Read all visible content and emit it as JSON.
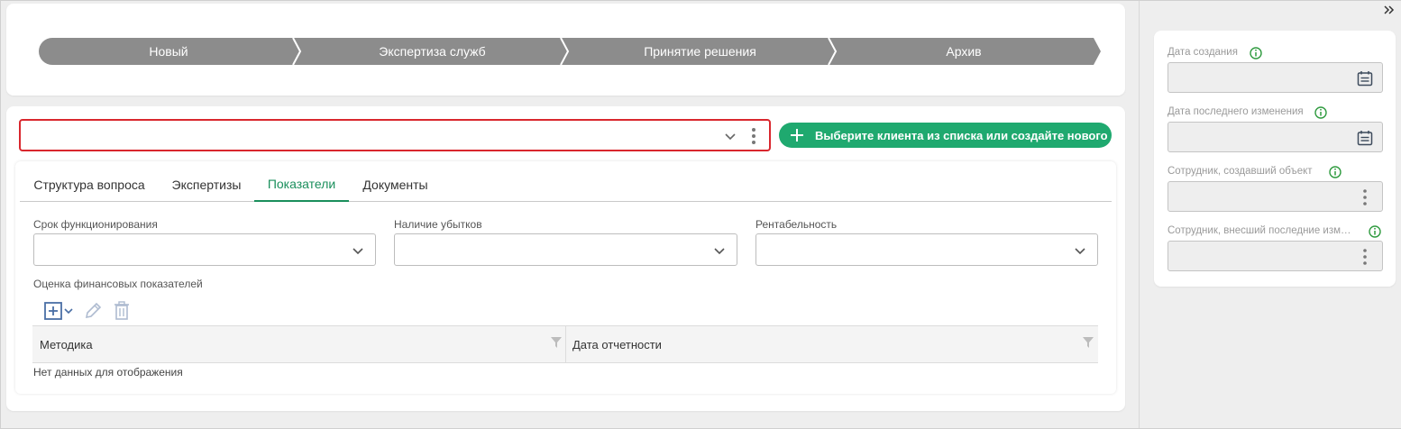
{
  "stages": [
    "Новый",
    "Экспертиза служб",
    "Принятие решения",
    "Архив"
  ],
  "client": {
    "add_button_label": "Выберите клиента из списка или создайте нового"
  },
  "tabs": [
    {
      "label": "Структура вопроса",
      "active": false
    },
    {
      "label": "Экспертизы",
      "active": false
    },
    {
      "label": "Показатели",
      "active": true
    },
    {
      "label": "Документы",
      "active": false
    }
  ],
  "fields": {
    "term_label": "Срок функционирования",
    "losses_label": "Наличие убытков",
    "profitability_label": "Рентабельность",
    "assessment_label": "Оценка финансовых показателей"
  },
  "grid": {
    "columns": [
      "Методика",
      "Дата отчетности"
    ],
    "empty_text": "Нет данных для отображения"
  },
  "properties": {
    "created_date_label": "Дата создания",
    "modified_date_label": "Дата последнего изменения",
    "created_by_label": "Сотрудник, создавший объект",
    "modified_by_label": "Сотрудник, внесший последние изм…"
  },
  "colors": {
    "accent": "#1fa96f",
    "stage": "#8c8c8c",
    "error_border": "#d9272e",
    "info_icon": "#2e9a3e"
  }
}
